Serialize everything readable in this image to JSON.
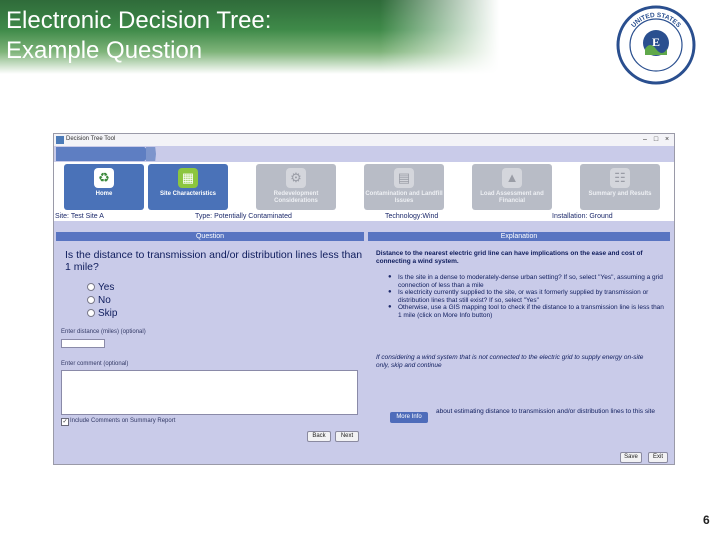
{
  "slide": {
    "title_line1": "Electronic Decision Tree:",
    "title_line2": "Example Question",
    "page_number": "6"
  },
  "logo": {
    "seal_text_top": "UNITED STATES",
    "seal_text_left": "ENVIRONMENTAL",
    "seal_text_right": "PROTECTION AGENCY",
    "seal_letter": "E"
  },
  "colors": {
    "header_green": "#3f8a49",
    "app_background": "#c9cbe9",
    "panel_header": "#5874c1",
    "active_tile": "#4a72b8",
    "text_navy": "#0e1c5c"
  },
  "window": {
    "title": "Decision Tree Tool",
    "minimize_icon": "minimize-icon",
    "maximize_icon": "maximize-icon",
    "close_icon": "close-icon"
  },
  "nav": {
    "tiles": [
      {
        "label": "Home",
        "icon": "recycle-icon",
        "state": "active"
      },
      {
        "label": "Site Characteristics",
        "icon": "building-icon",
        "state": "active"
      },
      {
        "label": "Redevelopment Considerations",
        "icon": "hardhat-icon",
        "state": "disabled"
      },
      {
        "label": "Contamination and Landfill Issues",
        "icon": "document-icon",
        "state": "disabled"
      },
      {
        "label": "Load Assessment and Financial",
        "icon": "chart-icon",
        "state": "disabled"
      },
      {
        "label": "Summary and Results",
        "icon": "clipboard-icon",
        "state": "disabled"
      }
    ]
  },
  "site_info": {
    "site": "Site: Test Site A",
    "type": "Type: Potentially Contaminated",
    "technology": "Technology:Wind",
    "installation": "Installation: Ground"
  },
  "question_panel": {
    "header": "Question",
    "question": "Is the distance to transmission and/or distribution lines less than 1 mile?",
    "options": [
      "Yes",
      "No",
      "Skip"
    ],
    "distance_label": "Enter distance (miles) (optional)",
    "distance_value": "",
    "comment_label": "Enter comment (optional)",
    "comment_value": "",
    "include_comments_label": "Include Comments on Summary Report",
    "include_comments_checked": true,
    "back_label": "Back",
    "next_label": "Next"
  },
  "explanation_panel": {
    "header": "Explanation",
    "intro": "Distance to the nearest electric grid line can have implications on the ease and cost of connecting a wind system.",
    "bullets": [
      "Is the site in a dense to moderately-dense urban setting? If so, select \"Yes\", assuming a grid connection of less than a mile",
      "Is electricity currently supplied to the site, or was it formerly supplied by transmission or distribution lines that still exist? If so, select \"Yes\"",
      "Otherwise, use a GIS mapping tool to check if the distance to a transmission line is less than 1 mile (click on More Info button)"
    ],
    "note": "If considering a wind system that is not connected to the electric grid to supply energy on-site only, skip and continue",
    "more_info_label": "More Info",
    "more_info_text": "about estimating distance to transmission and/or distribution lines to this site"
  },
  "footer": {
    "save_label": "Save",
    "exit_label": "Exit"
  }
}
